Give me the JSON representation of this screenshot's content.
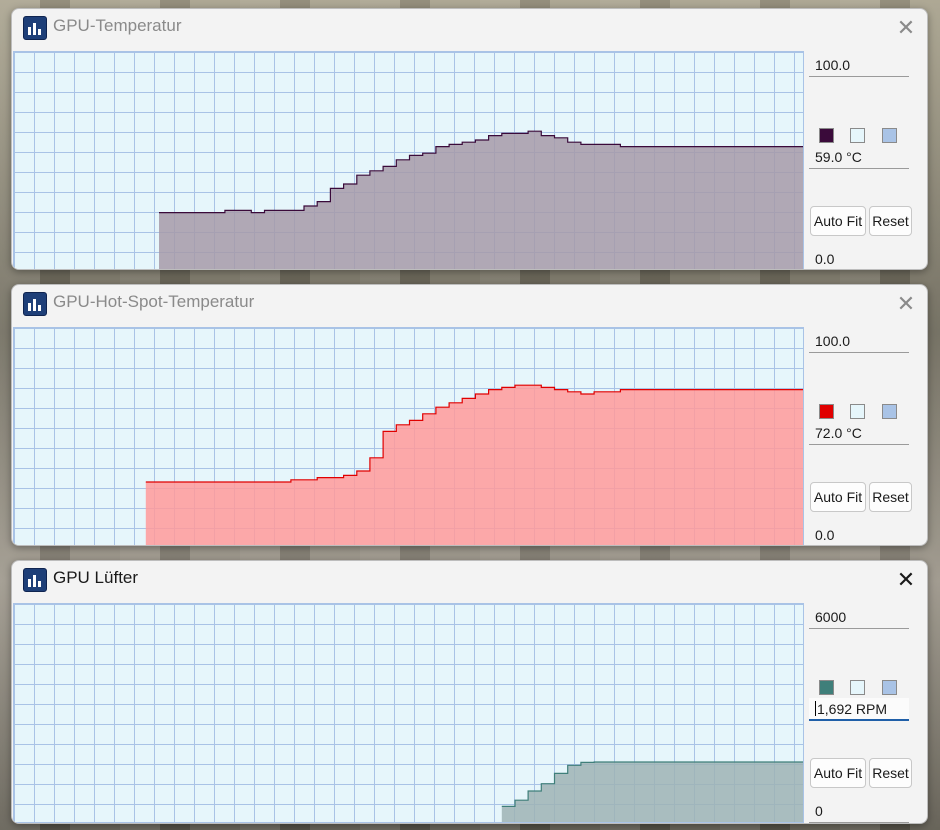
{
  "windows": [
    {
      "title": "GPU-Temperatur",
      "active": false,
      "max_value": "100.0",
      "current_value": "59.0 °C",
      "min_value": "0.0",
      "auto_fit_label": "Auto Fit",
      "reset_label": "Reset",
      "close_glyph": "✕",
      "colors": {
        "line": "#3a0a3a",
        "fill": "#a69aa8",
        "background": "#e6f6fb",
        "grid": "#a9c3e6"
      },
      "series": [
        null,
        null,
        null,
        null,
        null,
        null,
        null,
        null,
        null,
        null,
        null,
        27,
        27,
        27,
        27,
        27,
        28,
        28,
        27,
        28,
        28,
        28,
        30,
        32,
        38,
        40,
        44,
        46,
        48,
        51,
        53,
        54,
        57,
        58,
        59,
        60,
        62,
        63,
        63,
        64,
        62,
        61,
        59,
        58,
        58,
        58,
        57,
        57,
        57,
        57,
        57,
        57,
        57,
        57,
        57,
        57,
        57,
        57,
        57,
        57
      ]
    },
    {
      "title": "GPU-Hot-Spot-Temperatur",
      "active": false,
      "max_value": "100.0",
      "current_value": "72.0 °C",
      "min_value": "0.0",
      "auto_fit_label": "Auto Fit",
      "reset_label": "Reset",
      "close_glyph": "✕",
      "colors": {
        "line": "#e00000",
        "fill": "#ff9a9a",
        "background": "#e6f6fb",
        "grid": "#a9c3e6"
      },
      "series": [
        null,
        null,
        null,
        null,
        null,
        null,
        null,
        null,
        null,
        null,
        30,
        30,
        30,
        30,
        30,
        30,
        30,
        30,
        30,
        30,
        30,
        31,
        31,
        32,
        32,
        33,
        35,
        41,
        53,
        56,
        58,
        61,
        64,
        66,
        68,
        70,
        72,
        73,
        74,
        74,
        73,
        72,
        71,
        70,
        71,
        71,
        72,
        72,
        72,
        72,
        72,
        72,
        72,
        72,
        72,
        72,
        72,
        72,
        72,
        72
      ]
    },
    {
      "title": "GPU Lüfter",
      "active": true,
      "max_value": "6000",
      "current_value": "1,692 RPM",
      "min_value": "0",
      "auto_fit_label": "Auto Fit",
      "reset_label": "Reset",
      "close_glyph": "✕",
      "colors": {
        "line": "#3f7f7a",
        "fill": "#9db3b4",
        "background": "#e6f6fb",
        "grid": "#a9c3e6"
      },
      "series": [
        null,
        null,
        null,
        null,
        null,
        null,
        null,
        null,
        null,
        null,
        null,
        null,
        null,
        null,
        null,
        null,
        null,
        null,
        null,
        null,
        null,
        null,
        null,
        null,
        null,
        null,
        null,
        null,
        null,
        null,
        null,
        null,
        null,
        null,
        null,
        null,
        null,
        480,
        650,
        900,
        1100,
        1380,
        1600,
        1680,
        1692,
        1692,
        1692,
        1692,
        1692,
        1692,
        1692,
        1692,
        1692,
        1692,
        1692,
        1692,
        1692,
        1692,
        1692,
        1692
      ],
      "series_max": 6000
    }
  ]
}
